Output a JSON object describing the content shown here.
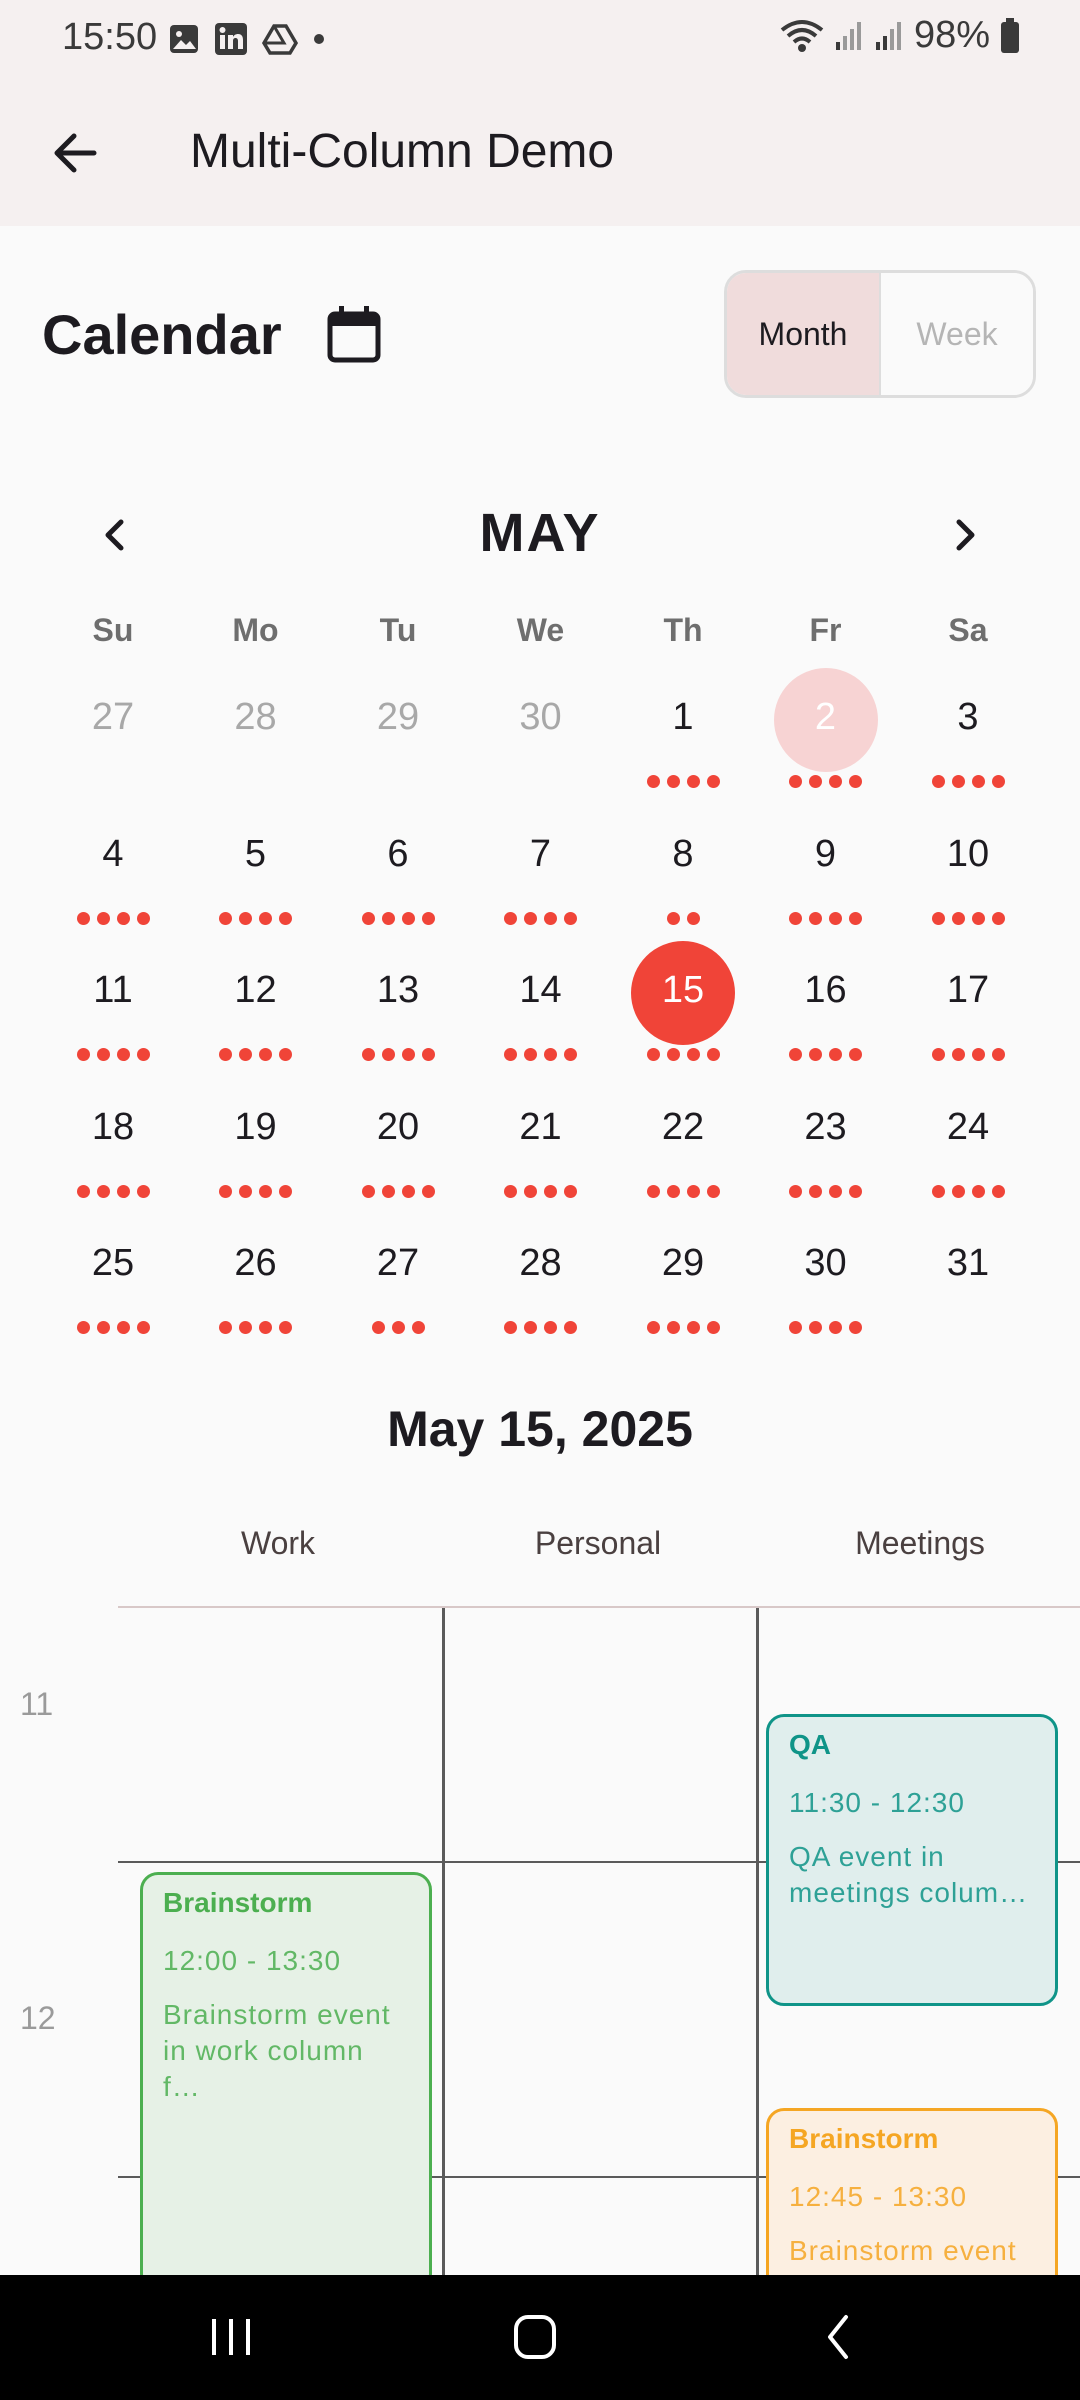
{
  "status": {
    "time": "15:50",
    "battery": "98%"
  },
  "appbar": {
    "title": "Multi-Column Demo"
  },
  "calendar": {
    "title": "Calendar",
    "view_month": "Month",
    "view_week": "Week",
    "month": "MAY",
    "weekdays": [
      "Su",
      "Mo",
      "Tu",
      "We",
      "Th",
      "Fr",
      "Sa"
    ],
    "weeks": [
      [
        {
          "d": "27",
          "out": true,
          "dots": 0
        },
        {
          "d": "28",
          "out": true,
          "dots": 0
        },
        {
          "d": "29",
          "out": true,
          "dots": 0
        },
        {
          "d": "30",
          "out": true,
          "dots": 0
        },
        {
          "d": "1",
          "dots": 4
        },
        {
          "d": "2",
          "dots": 4,
          "mark": "today"
        },
        {
          "d": "3",
          "dots": 4
        }
      ],
      [
        {
          "d": "4",
          "dots": 4
        },
        {
          "d": "5",
          "dots": 4
        },
        {
          "d": "6",
          "dots": 4
        },
        {
          "d": "7",
          "dots": 4
        },
        {
          "d": "8",
          "dots": 2
        },
        {
          "d": "9",
          "dots": 4
        },
        {
          "d": "10",
          "dots": 4
        }
      ],
      [
        {
          "d": "11",
          "dots": 4
        },
        {
          "d": "12",
          "dots": 4
        },
        {
          "d": "13",
          "dots": 4
        },
        {
          "d": "14",
          "dots": 4
        },
        {
          "d": "15",
          "dots": 4,
          "mark": "selected"
        },
        {
          "d": "16",
          "dots": 4
        },
        {
          "d": "17",
          "dots": 4
        }
      ],
      [
        {
          "d": "18",
          "dots": 4
        },
        {
          "d": "19",
          "dots": 4
        },
        {
          "d": "20",
          "dots": 4
        },
        {
          "d": "21",
          "dots": 4
        },
        {
          "d": "22",
          "dots": 4
        },
        {
          "d": "23",
          "dots": 4
        },
        {
          "d": "24",
          "dots": 4
        }
      ],
      [
        {
          "d": "25",
          "dots": 4
        },
        {
          "d": "26",
          "dots": 4
        },
        {
          "d": "27",
          "dots": 3
        },
        {
          "d": "28",
          "dots": 4
        },
        {
          "d": "29",
          "dots": 4
        },
        {
          "d": "30",
          "dots": 4
        },
        {
          "d": "31",
          "dots": 0
        }
      ]
    ]
  },
  "day_view": {
    "date": "May 15, 2025",
    "columns": [
      "Work",
      "Personal",
      "Meetings"
    ],
    "hours": [
      "11",
      "12"
    ],
    "events": [
      {
        "title": "QA",
        "time": "11:30 - 12:30",
        "desc": "QA event in meetings colum…",
        "color": "#0F9488",
        "bg": "#E0EEED"
      },
      {
        "title": "Brainstorm",
        "time": "12:00 - 13:30",
        "desc": "Brainstorm event in work column f…",
        "color": "#4CAF50",
        "bg": "#E6F1E6"
      },
      {
        "title": "Brainstorm",
        "time": "12:45 - 13:30",
        "desc": "Brainstorm event in meetings col…",
        "color": "#F5A623",
        "bg": "#FCEFE1"
      }
    ]
  },
  "colors": {
    "accent": "#F04438",
    "today_circle": "#F7D3D3"
  }
}
